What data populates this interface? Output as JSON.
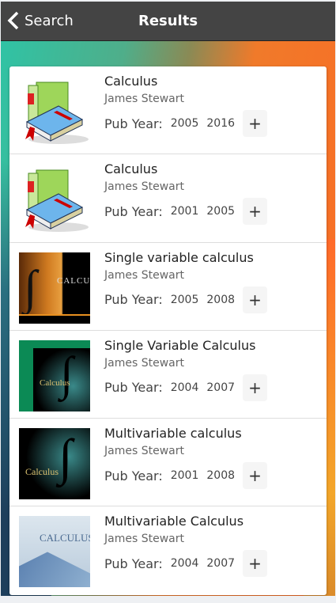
{
  "header": {
    "back_label": "Search",
    "title": "Results"
  },
  "pub_label": "Pub Year:",
  "add_label": "+",
  "results": [
    {
      "title": "Calculus",
      "author": "James Stewart",
      "years": [
        "2005",
        "2016"
      ],
      "cover": "generic-book-icon"
    },
    {
      "title": "Calculus",
      "author": "James Stewart",
      "years": [
        "2001",
        "2005"
      ],
      "cover": "generic-book-icon"
    },
    {
      "title": "Single variable calculus",
      "author": "James Stewart",
      "years": [
        "2005",
        "2008"
      ],
      "cover": "orange-violin-cover",
      "cover_text": "CALCULUS"
    },
    {
      "title": "Single Variable Calculus",
      "author": "James Stewart",
      "years": [
        "2004",
        "2007"
      ],
      "cover": "green-violin-cover",
      "cover_text": "Calculus"
    },
    {
      "title": "Multivariable calculus",
      "author": "James Stewart",
      "years": [
        "2001",
        "2008"
      ],
      "cover": "black-violin-cover",
      "cover_text": "Calculus"
    },
    {
      "title": "Multivariable Calculus",
      "author": "James Stewart",
      "years": [
        "2004",
        "2007"
      ],
      "cover": "blue-building-cover",
      "cover_text": "CALCULUS"
    }
  ]
}
